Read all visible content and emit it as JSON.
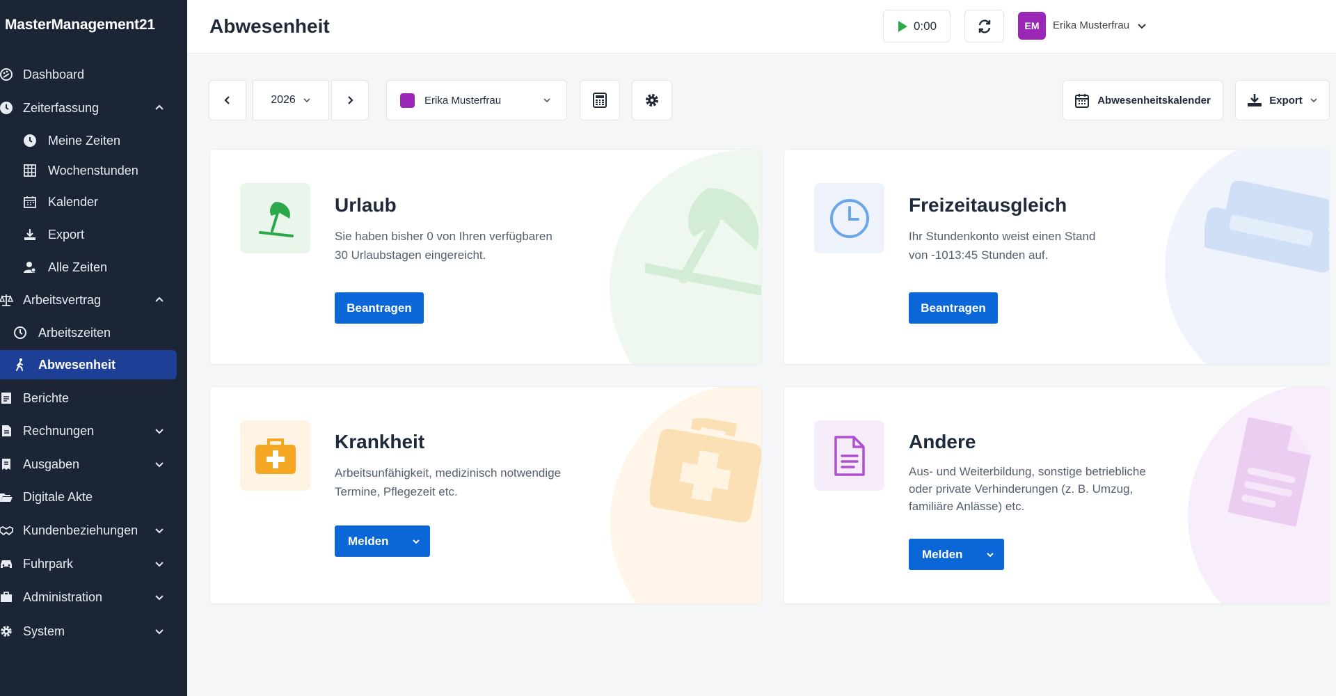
{
  "app": {
    "brand": "MasterManagement21"
  },
  "sidebar": {
    "items": [
      {
        "label": "Dashboard",
        "icon": "palette-icon"
      },
      {
        "label": "Zeiterfassung",
        "icon": "clock-icon",
        "chevron": "up"
      },
      {
        "label": "Meine Zeiten",
        "icon": "clock-icon"
      },
      {
        "label": "Wochenstunden",
        "icon": "grid-icon"
      },
      {
        "label": "Kalender",
        "icon": "calendar-icon"
      },
      {
        "label": "Export",
        "icon": "download-icon"
      },
      {
        "label": "Alle Zeiten",
        "icon": "users-icon"
      },
      {
        "label": "Arbeitsvertrag",
        "icon": "scale-icon",
        "chevron": "up"
      },
      {
        "label": "Arbeitszeiten",
        "icon": "clock-outline-icon"
      },
      {
        "label": "Abwesenheit",
        "icon": "walking-icon",
        "active": true
      },
      {
        "label": "Berichte",
        "icon": "report-icon"
      },
      {
        "label": "Rechnungen",
        "icon": "invoice-icon",
        "chevron": "down"
      },
      {
        "label": "Ausgaben",
        "icon": "receipt-icon",
        "chevron": "down"
      },
      {
        "label": "Digitale Akte",
        "icon": "folder-open-icon"
      },
      {
        "label": "Kundenbeziehungen",
        "icon": "handshake-icon",
        "chevron": "down"
      },
      {
        "label": "Fuhrpark",
        "icon": "car-icon",
        "chevron": "down"
      },
      {
        "label": "Administration",
        "icon": "briefcase-icon",
        "chevron": "down"
      },
      {
        "label": "System",
        "icon": "gear-icon",
        "chevron": "down"
      }
    ]
  },
  "header": {
    "title": "Abwesenheit",
    "timer": "0:00",
    "user": {
      "initials": "EM",
      "name": "Erika Musterfrau"
    }
  },
  "toolbar": {
    "year": "2026",
    "selected_user": "Erika Musterfrau",
    "calendar_button": "Abwesenheitskalender",
    "export_button": "Export"
  },
  "cards": {
    "urlaub": {
      "title": "Urlaub",
      "text_1": "Sie haben bisher 0 von Ihren verfügbaren",
      "text_2": "30 Urlaubstagen eingereicht.",
      "button": "Beantragen"
    },
    "freizeit": {
      "title": "Freizeitausgleich",
      "text_1": "Ihr Stundenkonto weist einen Stand",
      "text_2": "von -1013:45 Stunden auf.",
      "button": "Beantragen"
    },
    "krankheit": {
      "title": "Krankheit",
      "text_1": "Arbeitsunfähigkeit, medizinisch notwendige",
      "text_2": "Termine, Pflegezeit etc.",
      "button": "Melden"
    },
    "andere": {
      "title": "Andere",
      "text_1": "Aus- und Weiterbildung, sonstige betriebliche",
      "text_2": "oder private Verhinderungen (z. B. Umzug,",
      "text_3": "familiäre Anlässe) etc.",
      "button": "Melden"
    }
  },
  "colors": {
    "sidebar_bg": "#1b2536",
    "active_bg": "#1e3f96",
    "primary": "#0b67d7",
    "user_color": "#9b27b7",
    "green": "#2ba84a",
    "blue": "#6aa6e8",
    "orange": "#f5a623",
    "purple": "#b04fd0"
  }
}
